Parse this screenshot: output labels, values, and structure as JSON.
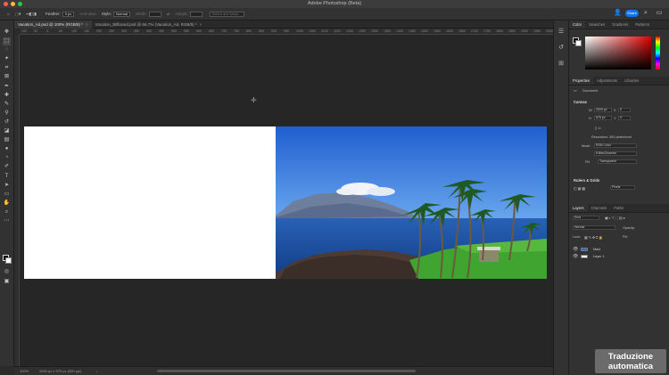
{
  "window": {
    "title": "Adobe Photoshop (Beta)"
  },
  "options_bar": {
    "feather_label": "Feather:",
    "feather_value": "0 px",
    "anti_alias_label": "Anti-alias",
    "style_label": "Style:",
    "style_value": "Normal",
    "width_label": "Width:",
    "height_label": "Height:",
    "select_mask_label": "Select and Mask...",
    "share_label": "Share"
  },
  "tabs": [
    {
      "label": "Vacation_Ad.psd @ 100% (RGB/8) *",
      "active": true
    },
    {
      "label": "Vacation_Billboard.psd @ 66.7% (Vacation_Ad, RGB/8) *",
      "active": false
    }
  ],
  "ruler_marks": [
    "100",
    "50",
    "0",
    "50",
    "100",
    "150",
    "200",
    "250",
    "300",
    "350",
    "400",
    "450",
    "500",
    "550",
    "600",
    "650",
    "700",
    "750",
    "800",
    "850",
    "900",
    "950",
    "1000",
    "1050",
    "1100",
    "1150",
    "1200",
    "1250",
    "1300",
    "1350",
    "1400",
    "1450",
    "1500",
    "1550",
    "1600",
    "1650",
    "1700",
    "1750",
    "1800",
    "1850",
    "1900",
    "1950",
    "2000"
  ],
  "status": {
    "zoom": "100%",
    "doc_size": "2000 px x 575 px (300 ppi)"
  },
  "color_panel": {
    "tabs": [
      "Color",
      "Swatches",
      "Gradients",
      "Patterns"
    ]
  },
  "properties": {
    "tabs": [
      "Properties",
      "Adjustments",
      "Libraries"
    ],
    "type": "Document",
    "canvas_header": "Canvas",
    "w_label": "W",
    "w_value": "2000 px",
    "h_label": "H",
    "h_value": "575 px",
    "x_label": "X",
    "x_value": "0",
    "y_label": "Y",
    "y_value": "0",
    "resolution": "Resolution: 300 pixels/inch",
    "mode_label": "Mode",
    "mode_value": "RGB Color",
    "bits_value": "8 Bits/Channel",
    "fill_label": "Fill",
    "fill_value": "Transparent",
    "rulers_header": "Rulers & Grids",
    "units_value": "Pixels"
  },
  "layers": {
    "tabs": [
      "Layers",
      "Channels",
      "Paths"
    ],
    "kind_value": "Kind",
    "blend_value": "Normal",
    "opacity_label": "Opacity:",
    "lock_label": "Lock:",
    "fill_label": "Fill:",
    "items": [
      {
        "name": "Maui"
      },
      {
        "name": "Layer 1"
      }
    ]
  },
  "watermark": {
    "line1": "Traduzione",
    "line2": "automatica"
  },
  "colors": {
    "share": "#1473e6",
    "sky": "#2a6fd6",
    "sea": "#1c4f9a",
    "grass": "#3aa02d"
  }
}
